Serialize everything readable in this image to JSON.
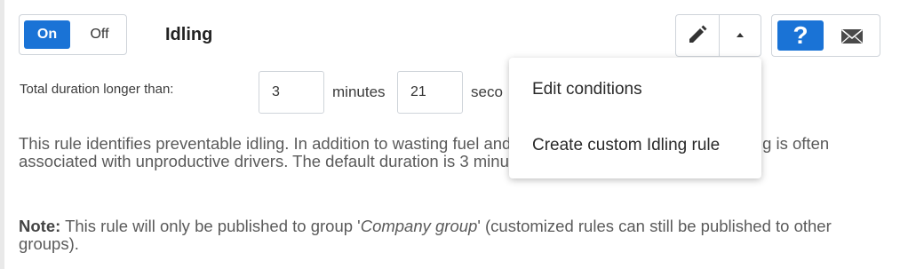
{
  "toggle": {
    "on_label": "On",
    "off_label": "Off",
    "state": "on"
  },
  "rule": {
    "title": "Idling"
  },
  "duration": {
    "label": "Total duration longer than:",
    "minutes_value": "3",
    "minutes_unit": "minutes",
    "seconds_value": "21",
    "seconds_unit": "seco"
  },
  "description": {
    "text": "This rule identifies preventable idling. In addition to wasting fuel and increasing vehicle emissions, idling is often associated with unproductive drivers. The default duration is 3 minutes 21 seconds."
  },
  "note": {
    "label": "Note:",
    "before_group": " This rule will only be published to group '",
    "group_name": "Company group",
    "after_group": "' (customized rules can still be published to other groups)."
  },
  "toolbar": {
    "edit_icon": "pencil-icon",
    "caret_icon": "caret-up-icon",
    "help_label": "?",
    "mail_icon": "envelope-icon"
  },
  "dropdown": {
    "items": [
      {
        "label": "Edit conditions"
      },
      {
        "label": "Create custom Idling rule"
      }
    ]
  },
  "colors": {
    "accent": "#1a73d6",
    "border": "#cfd4da",
    "text": "#5a5a5a"
  }
}
